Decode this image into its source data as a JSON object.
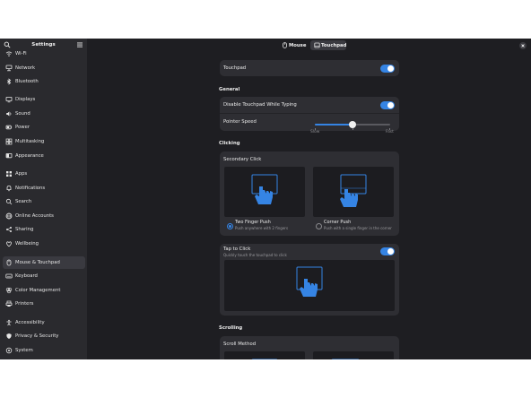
{
  "sidebar": {
    "title": "Settings",
    "items": [
      {
        "label": "Wi-Fi",
        "icon": "wifi-icon"
      },
      {
        "label": "Network",
        "icon": "network-icon"
      },
      {
        "label": "Bluetooth",
        "icon": "bluetooth-icon"
      },
      {
        "label": "Displays",
        "icon": "display-icon"
      },
      {
        "label": "Sound",
        "icon": "sound-icon"
      },
      {
        "label": "Power",
        "icon": "power-icon"
      },
      {
        "label": "Multitasking",
        "icon": "multitasking-icon"
      },
      {
        "label": "Appearance",
        "icon": "appearance-icon"
      },
      {
        "label": "Apps",
        "icon": "apps-icon"
      },
      {
        "label": "Notifications",
        "icon": "bell-icon"
      },
      {
        "label": "Search",
        "icon": "search-icon"
      },
      {
        "label": "Online Accounts",
        "icon": "online-accounts-icon"
      },
      {
        "label": "Sharing",
        "icon": "sharing-icon"
      },
      {
        "label": "Wellbeing",
        "icon": "wellbeing-icon"
      },
      {
        "label": "Mouse & Touchpad",
        "icon": "mouse-icon"
      },
      {
        "label": "Keyboard",
        "icon": "keyboard-icon"
      },
      {
        "label": "Color Management",
        "icon": "color-icon"
      },
      {
        "label": "Printers",
        "icon": "printer-icon"
      },
      {
        "label": "Accessibility",
        "icon": "accessibility-icon"
      },
      {
        "label": "Privacy & Security",
        "icon": "privacy-icon"
      },
      {
        "label": "System",
        "icon": "system-icon"
      }
    ],
    "active_index": 14
  },
  "tabs": [
    {
      "label": "Mouse",
      "icon": "mouse-icon",
      "active": false
    },
    {
      "label": "Touchpad",
      "icon": "touchpad-icon",
      "active": true
    }
  ],
  "touchpad": {
    "label": "Touchpad",
    "enabled": true
  },
  "general": {
    "title": "General",
    "disable_while_typing": {
      "label": "Disable Touchpad While Typing",
      "enabled": true
    },
    "pointer_speed": {
      "label": "Pointer Speed",
      "value": 0.5,
      "min_label": "Slow",
      "max_label": "Fast"
    }
  },
  "clicking": {
    "title": "Clicking",
    "secondary_click": {
      "label": "Secondary Click",
      "options": [
        {
          "title": "Two Finger Push",
          "subtitle": "Push anywhere with 2 fingers",
          "selected": true
        },
        {
          "title": "Corner Push",
          "subtitle": "Push with a single finger in the corner",
          "selected": false
        }
      ]
    },
    "tap_to_click": {
      "label": "Tap to Click",
      "subtitle": "Quickly touch the touchpad to click",
      "enabled": true
    }
  },
  "scrolling": {
    "title": "Scrolling",
    "scroll_method": {
      "label": "Scroll Method"
    }
  },
  "colors": {
    "accent": "#3584e4",
    "window_bg": "#1e1e22",
    "sidebar_bg": "#2a2a2e",
    "card_bg": "#2e2e33"
  }
}
